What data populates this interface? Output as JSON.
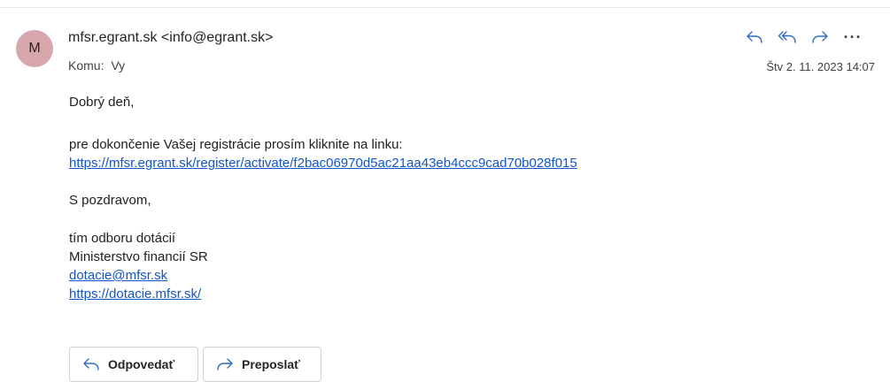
{
  "header": {
    "avatar_letter": "M",
    "sender": "mfsr.egrant.sk <info@egrant.sk>",
    "to_label": "Komu:",
    "to_value": "Vy",
    "date": "Štv 2. 11. 2023 14:07",
    "actions": {
      "reply_icon": "reply-icon",
      "reply_all_icon": "reply-all-icon",
      "forward_icon": "forward-icon",
      "more_label": "···"
    }
  },
  "message": {
    "greeting": "Dobrý deň,",
    "instruction": "pre dokončenie Vašej registrácie prosím kliknite na linku:",
    "activation_link": "https://mfsr.egrant.sk/register/activate/f2bac06970d5ac21aa43eb4ccc9cad70b028f015",
    "closing": "S pozdravom,",
    "signature": {
      "team": "tím odboru dotácií",
      "ministry": "Ministerstvo financií SR",
      "email": "dotacie@mfsr.sk",
      "website": "https://dotacie.mfsr.sk/"
    }
  },
  "footer": {
    "reply_label": "Odpovedať",
    "forward_label": "Preposlať"
  },
  "colors": {
    "avatar_bg": "#d8a6ad",
    "accent": "#2f6dbf",
    "link": "#1155cc"
  }
}
